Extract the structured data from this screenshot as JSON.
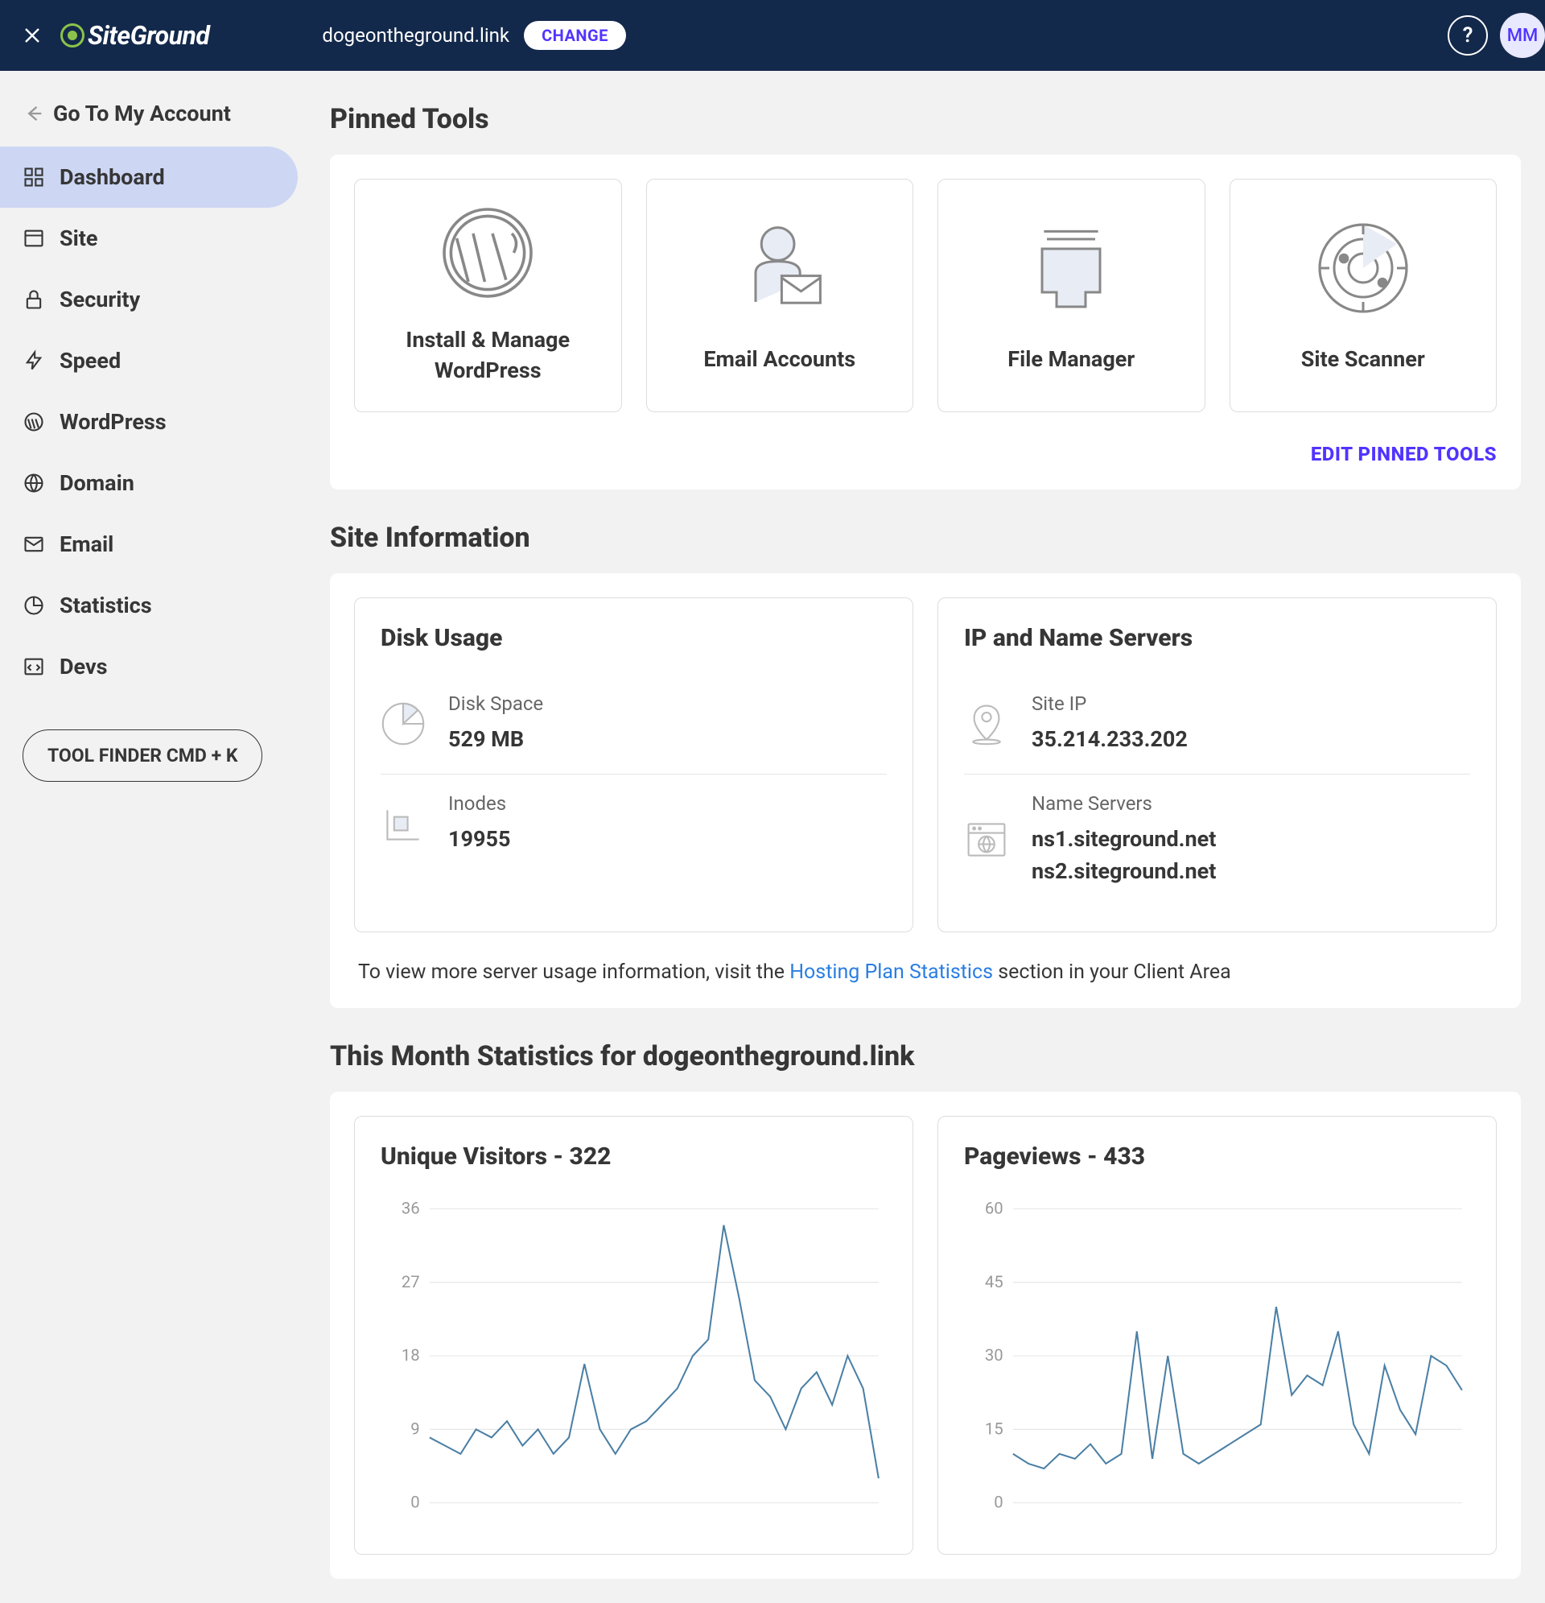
{
  "header": {
    "logo_text": "SiteGround",
    "domain": "dogeontheground.link",
    "change_label": "CHANGE",
    "avatar_initials": "MM"
  },
  "sidebar": {
    "back_label": "Go To My Account",
    "items": [
      {
        "label": "Dashboard",
        "active": true
      },
      {
        "label": "Site"
      },
      {
        "label": "Security"
      },
      {
        "label": "Speed"
      },
      {
        "label": "WordPress"
      },
      {
        "label": "Domain"
      },
      {
        "label": "Email"
      },
      {
        "label": "Statistics"
      },
      {
        "label": "Devs"
      }
    ],
    "tool_finder_label": "TOOL FINDER CMD + K"
  },
  "pinned": {
    "title": "Pinned Tools",
    "edit_label": "EDIT PINNED TOOLS",
    "tiles": [
      {
        "label": "Install & Manage WordPress"
      },
      {
        "label": "Email Accounts"
      },
      {
        "label": "File Manager"
      },
      {
        "label": "Site Scanner"
      }
    ]
  },
  "site_info": {
    "title": "Site Information",
    "disk_panel": {
      "title": "Disk Usage",
      "rows": [
        {
          "k": "Disk Space",
          "v": "529 MB"
        },
        {
          "k": "Inodes",
          "v": "19955"
        }
      ]
    },
    "ip_panel": {
      "title": "IP and Name Servers",
      "rows": [
        {
          "k": "Site IP",
          "v": "35.214.233.202"
        },
        {
          "k": "Name Servers",
          "v": "ns1.siteground.net\nns2.siteground.net"
        }
      ]
    },
    "note_prefix": "To view more server usage information, visit the ",
    "note_link": "Hosting Plan Statistics",
    "note_suffix": " section in your Client Area"
  },
  "stats": {
    "title": "This Month Statistics for dogeontheground.link",
    "visitors_title": "Unique Visitors - 322",
    "pageviews_title": "Pageviews - 433"
  },
  "chart_data": [
    {
      "type": "line",
      "title": "Unique Visitors - 322",
      "xlabel": "",
      "ylabel": "",
      "ylim": [
        0,
        36
      ],
      "yticks": [
        0,
        9,
        18,
        27,
        36
      ],
      "x": [
        1,
        2,
        3,
        4,
        5,
        6,
        7,
        8,
        9,
        10,
        11,
        12,
        13,
        14,
        15,
        16,
        17,
        18,
        19,
        20,
        21,
        22,
        23,
        24,
        25,
        26,
        27,
        28,
        29,
        30
      ],
      "values": [
        8,
        7,
        6,
        9,
        8,
        10,
        7,
        9,
        6,
        8,
        17,
        9,
        6,
        9,
        10,
        12,
        14,
        18,
        20,
        34,
        25,
        15,
        13,
        9,
        14,
        16,
        12,
        18,
        14,
        3
      ]
    },
    {
      "type": "line",
      "title": "Pageviews - 433",
      "xlabel": "",
      "ylabel": "",
      "ylim": [
        0,
        60
      ],
      "yticks": [
        0,
        15,
        30,
        45,
        60
      ],
      "x": [
        1,
        2,
        3,
        4,
        5,
        6,
        7,
        8,
        9,
        10,
        11,
        12,
        13,
        14,
        15,
        16,
        17,
        18,
        19,
        20,
        21,
        22,
        23,
        24,
        25,
        26,
        27,
        28,
        29,
        30
      ],
      "values": [
        10,
        8,
        7,
        10,
        9,
        12,
        8,
        10,
        35,
        9,
        30,
        10,
        8,
        10,
        12,
        14,
        16,
        40,
        22,
        26,
        24,
        35,
        16,
        10,
        28,
        19,
        14,
        30,
        28,
        23
      ]
    }
  ]
}
